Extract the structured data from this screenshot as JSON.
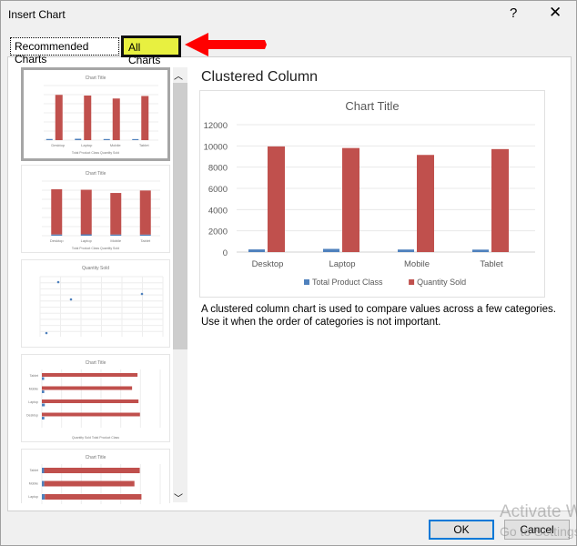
{
  "dialog": {
    "title": "Insert Chart",
    "help": "?",
    "close": "✕"
  },
  "tabs": [
    {
      "label": "Recommended Charts"
    },
    {
      "label": "All Charts"
    }
  ],
  "annotation": {
    "arrow_color": "#ff0000",
    "highlight_color": "#e8f040"
  },
  "thumbnails": [
    {
      "title": "Chart Title",
      "legend": [
        "Total Product Class",
        "Quantity Sold"
      ]
    },
    {
      "title": "Chart Title",
      "legend": [
        "Total Product Class",
        "Quantity Sold"
      ]
    },
    {
      "title": "Quantity Sold"
    },
    {
      "title": "Chart Title",
      "legend": [
        "Quantity Sold",
        "Total Product Class"
      ]
    },
    {
      "title": "Chart Title"
    }
  ],
  "preview": {
    "chart_type_name": "Clustered Column",
    "description": "A clustered column chart is used to compare values across a few categories. Use it when the order of categories is not important."
  },
  "chart_data": {
    "type": "bar",
    "title": "Chart Title",
    "categories": [
      "Desktop",
      "Laptop",
      "Mobile",
      "Tablet"
    ],
    "series": [
      {
        "name": "Total Product Class",
        "values": [
          250,
          300,
          240,
          230
        ],
        "color": "#4f81bd"
      },
      {
        "name": "Quantity Sold",
        "values": [
          9950,
          9800,
          9150,
          9700
        ],
        "color": "#c0504d"
      }
    ],
    "ylim": [
      0,
      12000
    ],
    "yticks": [
      "0",
      "2000",
      "4000",
      "6000",
      "8000",
      "10000",
      "12000"
    ],
    "grid": true,
    "legend": "bottom"
  },
  "buttons": {
    "ok": "OK",
    "cancel": "Cancel"
  },
  "watermark": {
    "line1": "Activate W",
    "line2": "Go to Settings"
  }
}
